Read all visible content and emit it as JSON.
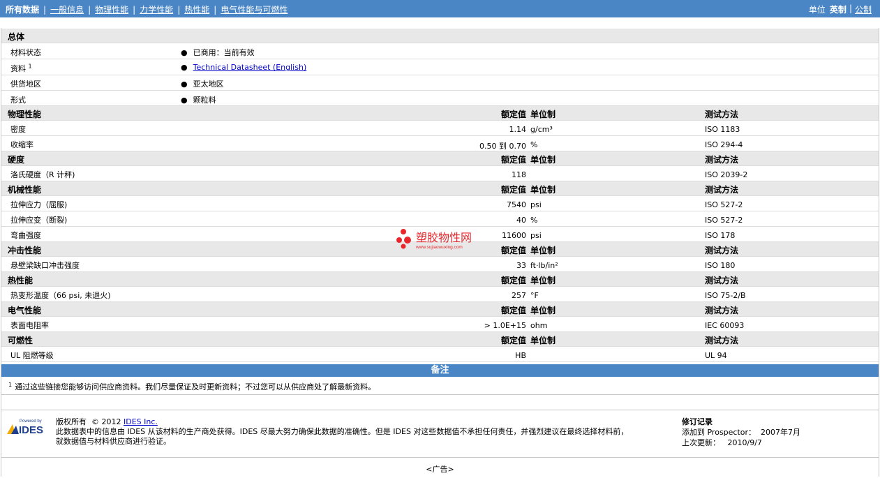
{
  "nav": {
    "items": [
      "所有数据",
      "一般信息",
      "物理性能",
      "力学性能",
      "热性能",
      "电气性能与可燃性"
    ]
  },
  "units": {
    "label": "单位",
    "selected": "英制",
    "other": "公制"
  },
  "general": {
    "title": "总体",
    "rows": [
      {
        "label": "材料状态",
        "value": "已商用：当前有效"
      },
      {
        "label": "资料",
        "sup": "1",
        "value": "Technical Datasheet (English)"
      },
      {
        "label": "供货地区",
        "value": "亚太地区"
      },
      {
        "label": "形式",
        "value": "颗粒料"
      }
    ]
  },
  "col_headers": {
    "nominal": "额定值",
    "unit": "单位制",
    "method": "测试方法"
  },
  "sections": [
    {
      "title": "物理性能",
      "rows": [
        {
          "label": "密度",
          "value": "1.14",
          "unit": "g/cm³",
          "method": "ISO 1183"
        },
        {
          "label": "收缩率",
          "value": "0.50 到  0.70",
          "unit": "%",
          "method": "ISO 294-4"
        }
      ]
    },
    {
      "title": "硬度",
      "rows": [
        {
          "label": "洛氏硬度（R 计秤)",
          "value": "118",
          "unit": "",
          "method": "ISO 2039-2"
        }
      ]
    },
    {
      "title": "机械性能",
      "rows": [
        {
          "label": "拉伸应力（屈服)",
          "value": "7540",
          "unit": "psi",
          "method": "ISO 527-2"
        },
        {
          "label": "拉伸应变（断裂)",
          "value": "40",
          "unit": "%",
          "method": "ISO 527-2"
        },
        {
          "label": "弯曲强度",
          "value": "11600",
          "unit": "psi",
          "method": "ISO 178"
        }
      ]
    },
    {
      "title": "冲击性能",
      "rows": [
        {
          "label": "悬壁梁缺口冲击强度",
          "value": "33",
          "unit": "ft·lb/in²",
          "method": "ISO 180"
        }
      ]
    },
    {
      "title": "热性能",
      "rows": [
        {
          "label": "热变形温度（66 psi, 未退火)",
          "value": "257",
          "unit": "°F",
          "method": "ISO 75-2/B"
        }
      ]
    },
    {
      "title": "电气性能",
      "rows": [
        {
          "label": "表面电阻率",
          "value": "> 1.0E+15",
          "unit": "ohm",
          "method": "IEC 60093"
        }
      ]
    },
    {
      "title": "可燃性",
      "rows": [
        {
          "label": "UL 阻燃等级",
          "value": "HB",
          "unit": "",
          "method": "UL 94"
        }
      ]
    }
  ],
  "notes": {
    "title": "备注",
    "sup": "1",
    "text": "通过这些链接您能够访问供应商资料。我们尽量保证及时更新资料；不过您可以从供应商处了解最新资料。"
  },
  "watermark": {
    "title": "塑胶物性网",
    "url": "www.sujiaowuxing.com"
  },
  "footer": {
    "logo_top": "Powered by",
    "logo_text": "IDES",
    "copyright_label": "版权所有",
    "copyright_year": "© 2012",
    "company": "IDES Inc.",
    "disclaimer_1": "此数据表中的信息由  IDES 从该材料的生产商处获得。IDES 尽最大努力确保此数据的准确性。但是  IDES 对这些数据值不承担任何责任，并强烈建议在最终选择材料前，",
    "disclaimer_2": "就数据值与材料供应商进行验证。",
    "revision_title": "修订记录",
    "added_label": "添加到  Prospector：",
    "added_value": "2007年7月",
    "updated_label": "上次更新：",
    "updated_value": "2010/9/7",
    "ad": "<广告>"
  },
  "colors": {
    "header_bar": "#4a86c5",
    "row_shade": "#e8e8e8",
    "link": "#0000cc",
    "watermark_red": "#e8262b"
  }
}
